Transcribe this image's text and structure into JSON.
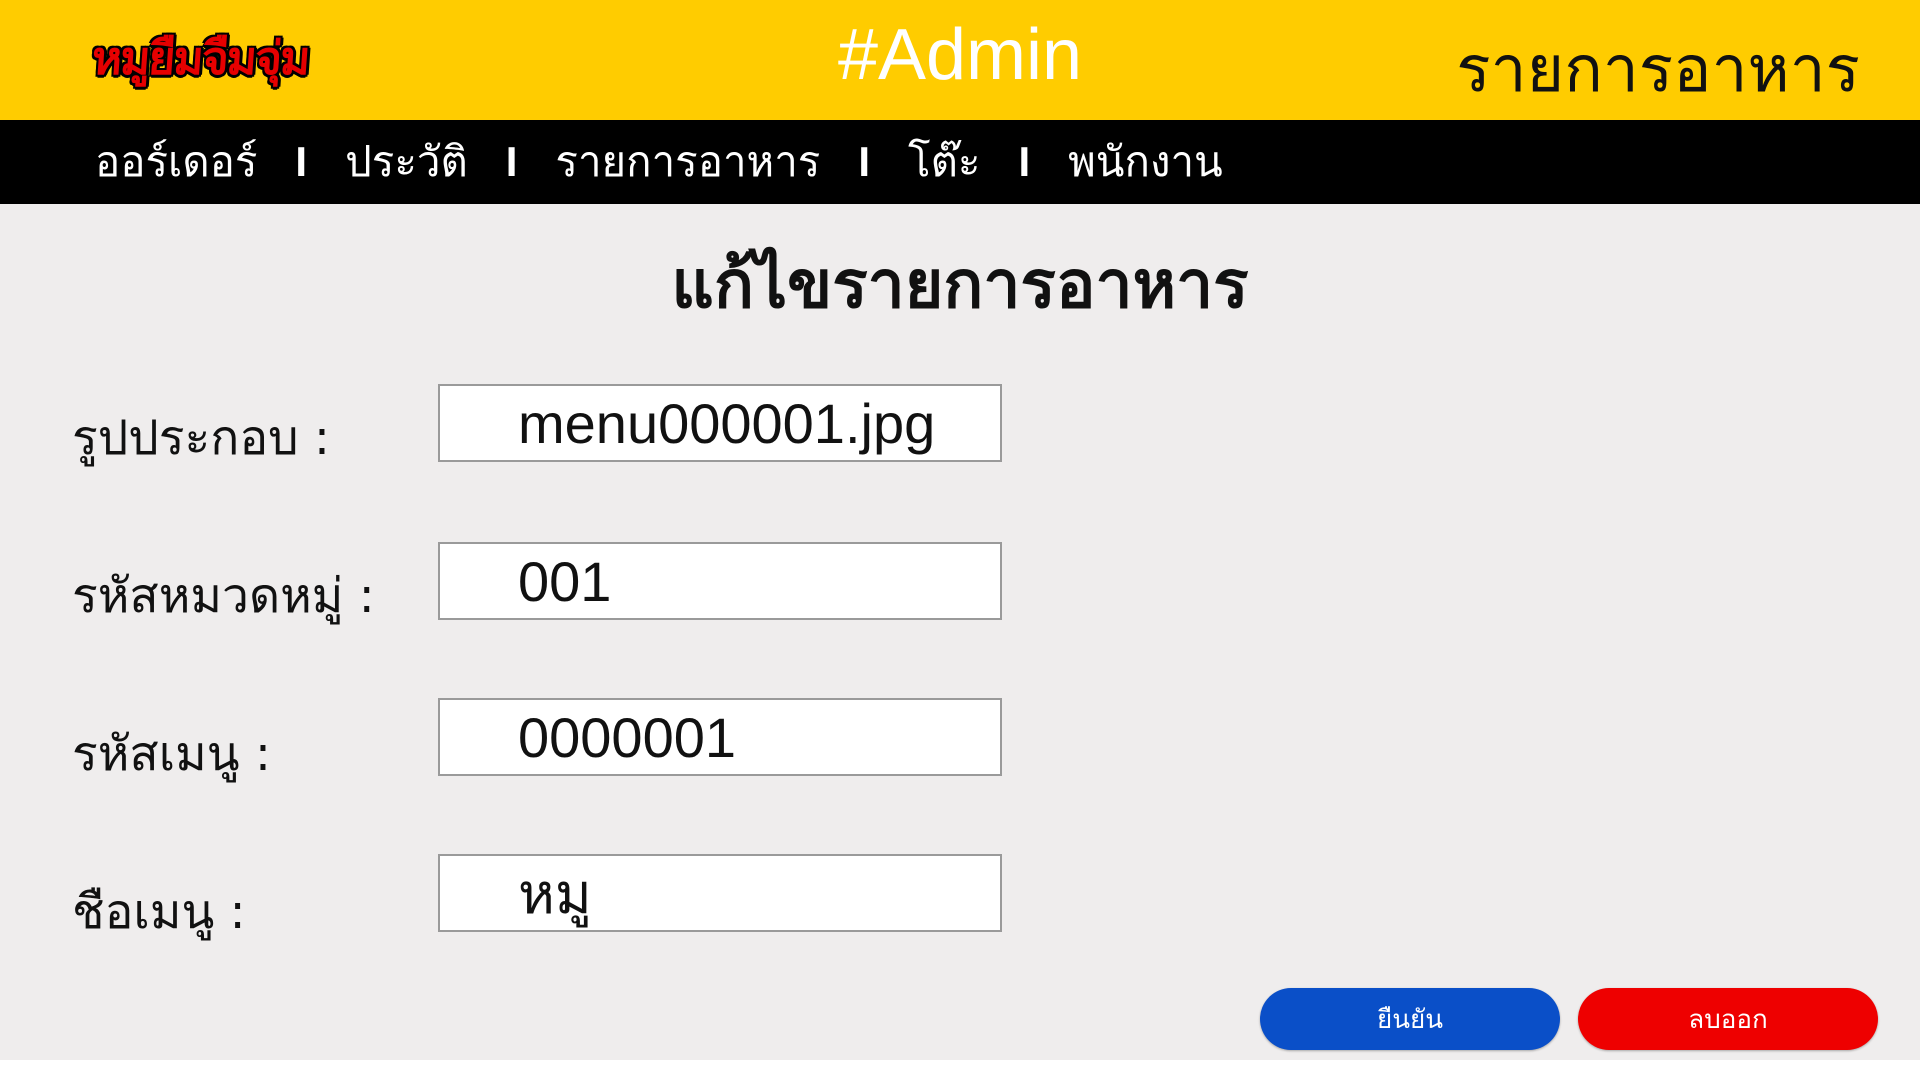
{
  "header": {
    "logo_text": "หมูยืมจืมจุ่ม",
    "admin_title": "#Admin",
    "section_title": "รายการอาหาร"
  },
  "nav": {
    "items": [
      "ออร์เดอร์",
      "ประวัติ",
      "รายการอาหาร",
      "โต๊ะ",
      "พนักงาน"
    ],
    "separator": "I"
  },
  "page": {
    "title": "แก้ไขรายการอาหาร"
  },
  "form": {
    "image": {
      "label": "รูปประกอบ :",
      "value": "menu000001.jpg"
    },
    "category_code": {
      "label": "รหัสหมวดหมู่ :",
      "value": "001"
    },
    "menu_code": {
      "label": "รหัสเมนู :",
      "value": "0000001"
    },
    "menu_name": {
      "label": "ชือเมนู :",
      "value": "หมู"
    }
  },
  "buttons": {
    "confirm": "ยืนยัน",
    "delete": "ลบออก"
  },
  "colors": {
    "header_bg": "#ffcc00",
    "nav_bg": "#000000",
    "content_bg": "#efeded",
    "confirm_button": "#0a4fc8",
    "delete_button": "#ee0000",
    "logo_red": "#e60000"
  }
}
